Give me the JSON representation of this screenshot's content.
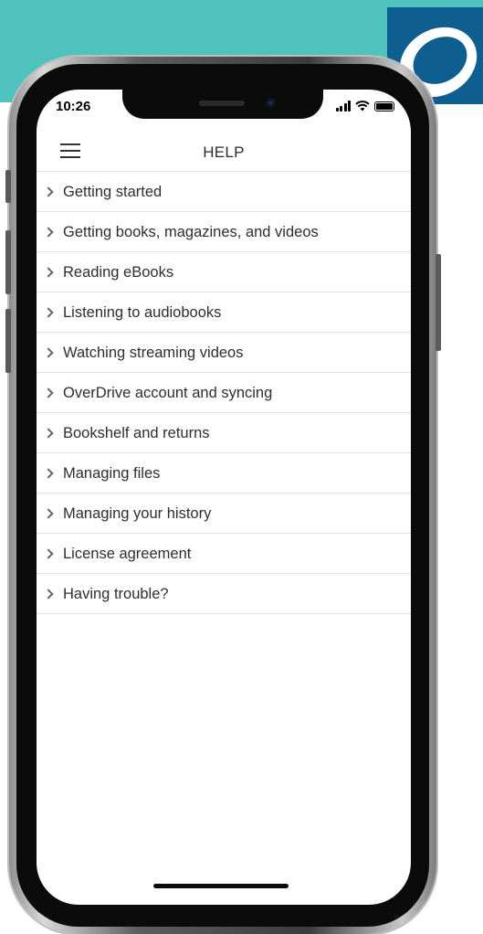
{
  "status_bar": {
    "time": "10:26"
  },
  "header": {
    "title": "HELP"
  },
  "help_items": [
    {
      "label": "Getting started"
    },
    {
      "label": "Getting books, magazines, and videos"
    },
    {
      "label": "Reading eBooks"
    },
    {
      "label": "Listening to audiobooks"
    },
    {
      "label": "Watching streaming videos"
    },
    {
      "label": "OverDrive account and syncing"
    },
    {
      "label": "Bookshelf and returns"
    },
    {
      "label": "Managing files"
    },
    {
      "label": "Managing your history"
    },
    {
      "label": "License agreement"
    },
    {
      "label": "Having trouble?"
    }
  ],
  "icons": {
    "menu": "hamburger-menu-icon",
    "chevron": "chevron-right-icon",
    "signal": "cellular-signal-icon",
    "wifi": "wifi-icon",
    "battery": "battery-icon",
    "logo": "overdrive-logo-icon"
  },
  "colors": {
    "teal_band": "#4fc2bd",
    "logo_blue": "#0e5f8f",
    "divider": "#e2e2e2",
    "text": "#2e2e2e"
  }
}
